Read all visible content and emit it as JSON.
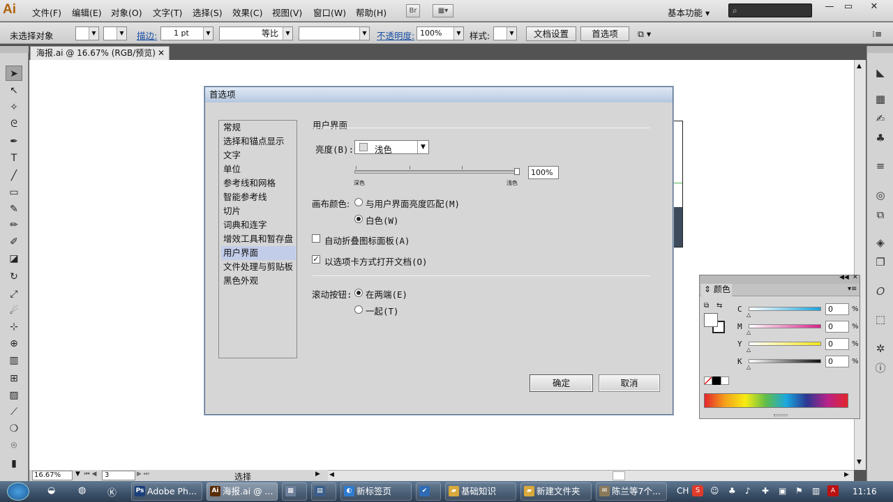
{
  "app": {
    "logo": "Ai",
    "menu": [
      "文件(F)",
      "编辑(E)",
      "对象(O)",
      "文字(T)",
      "选择(S)",
      "效果(C)",
      "视图(V)",
      "窗口(W)",
      "帮助(H)"
    ],
    "bridge_btn": "Br",
    "workspace": "基本功能",
    "window_controls": [
      "—",
      "▭",
      "✕"
    ]
  },
  "control_bar": {
    "selection": "未选择对象",
    "stroke_label": "描边:",
    "stroke_weight": "1 pt",
    "stroke_profile": "等比",
    "opacity_label": "不透明度:",
    "opacity_value": "100%",
    "style_label": "样式:",
    "doc_setup": "文档设置",
    "preferences": "首选项"
  },
  "document": {
    "tab_title": "海报.ai @ 16.67% (RGB/预览)",
    "close": "✕",
    "zoom": "16.67%",
    "artboard": "3",
    "status": "选择"
  },
  "dialog": {
    "title": "首选项",
    "categories": [
      "常规",
      "选择和锚点显示",
      "文字",
      "单位",
      "参考线和网格",
      "智能参考线",
      "切片",
      "词典和连字",
      "增效工具和暂存盘",
      "用户界面",
      "文件处理与剪贴板",
      "黑色外观"
    ],
    "selected_category": "用户界面",
    "section_title": "用户界面",
    "brightness_label": "亮度(B):",
    "brightness_value": "浅色",
    "brightness_percent": "100%",
    "slider_left": "深色",
    "slider_right": "浅色",
    "canvas_color_label": "画布颜色:",
    "canvas_option_1": "与用户界面亮度匹配(M)",
    "canvas_option_2": "白色(W)",
    "auto_collapse": "自动折叠图标面板(A)",
    "open_as_tabs": "以选项卡方式打开文档(O)",
    "scroll_label": "滚动按钮:",
    "scroll_option_1": "在两端(E)",
    "scroll_option_2": "一起(T)",
    "ok": "确定",
    "cancel": "取消"
  },
  "color_panel": {
    "title": "颜色",
    "channels": [
      {
        "label": "C",
        "value": "0",
        "pct": "%"
      },
      {
        "label": "M",
        "value": "0",
        "pct": "%"
      },
      {
        "label": "Y",
        "value": "0",
        "pct": "%"
      },
      {
        "label": "K",
        "value": "0",
        "pct": "%"
      }
    ]
  },
  "taskbar": {
    "items": [
      "Adobe Ph...",
      "海报.ai @ ...",
      "新标签页",
      "基础知识",
      "新建文件夹",
      "陈兰等7个..."
    ],
    "lang": "CH",
    "clock": "11:16"
  }
}
